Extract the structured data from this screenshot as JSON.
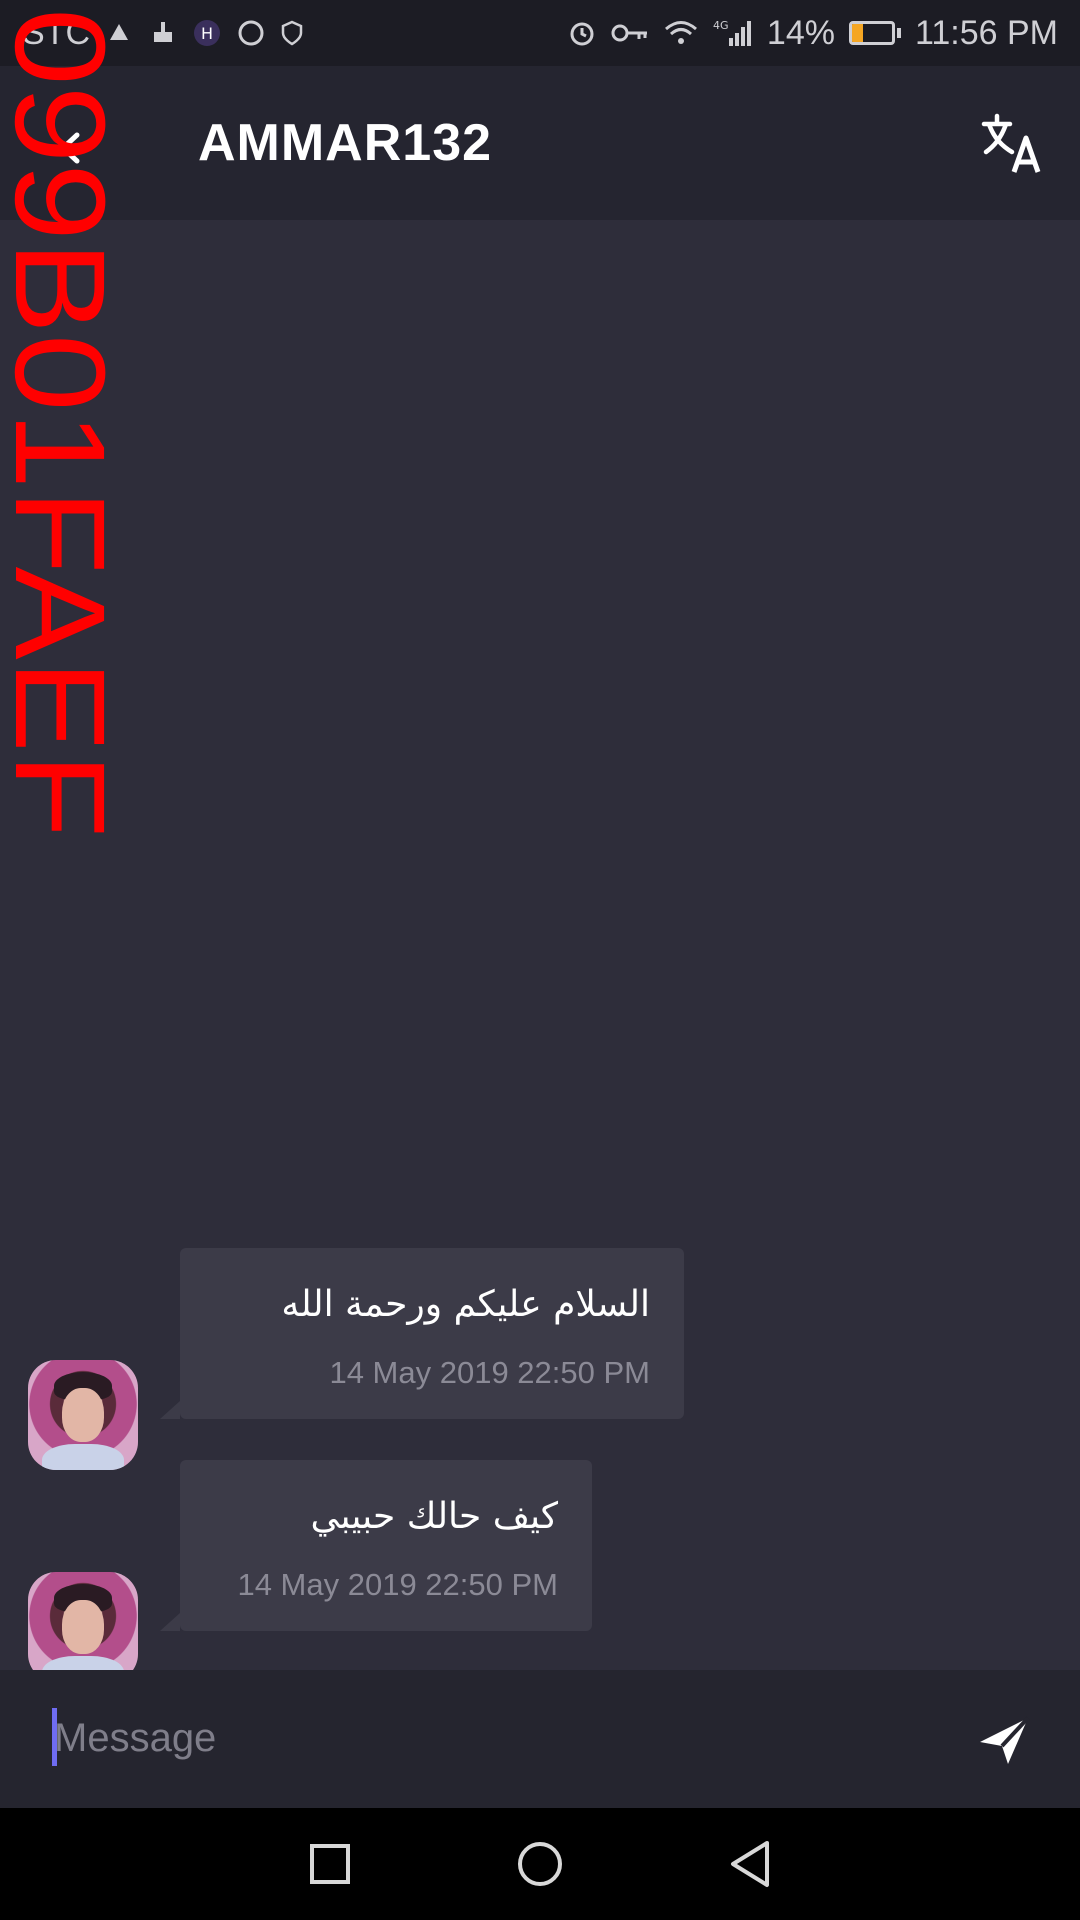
{
  "status_bar": {
    "carrier": "STC",
    "battery": "14%",
    "battery_level": 0.14,
    "time": "11:56 PM",
    "network": "4G"
  },
  "header": {
    "title": "AMMAR132",
    "back_icon": "back-arrow-icon",
    "translate_icon": "translate-icon"
  },
  "messages": [
    {
      "text": "السلام عليكم ورحمة الله",
      "time": "14 May 2019 22:50 PM"
    },
    {
      "text": "كيف حالك حبيبي",
      "time": "14 May 2019 22:50 PM"
    }
  ],
  "composer": {
    "placeholder": "Message",
    "value": ""
  },
  "watermark": "099B01FAEF",
  "colors": {
    "background": "#2e2d3a",
    "bubble": "#3c3b48",
    "accent_cursor": "#6f6cf2",
    "watermark": "#ff0000"
  }
}
